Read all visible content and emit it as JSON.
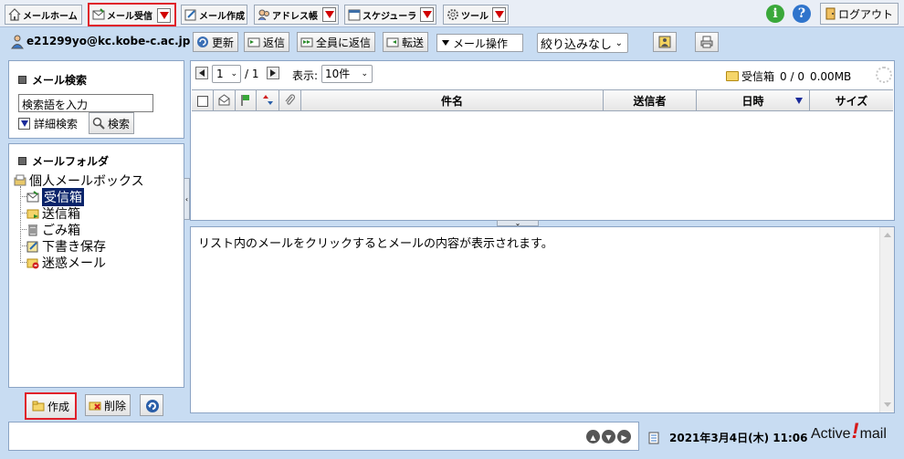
{
  "tabs": [
    {
      "label": "メールホーム",
      "icon": "home-icon"
    },
    {
      "label": "メール受信",
      "icon": "inbox-envelope-icon"
    },
    {
      "label": "メール作成",
      "icon": "compose-icon"
    },
    {
      "label": "アドレス帳",
      "icon": "address-book-icon"
    },
    {
      "label": "スケジューラ",
      "icon": "calendar-icon"
    },
    {
      "label": "ツール",
      "icon": "gear-icon"
    }
  ],
  "header": {
    "info_icon": "i",
    "help_icon": "?",
    "logout_label": "ログアウト"
  },
  "account": {
    "email": "e21299yo@kc.kobe-c.ac.jp"
  },
  "toolbar": {
    "refresh": "更新",
    "reply": "返信",
    "reply_all": "全員に返信",
    "forward": "転送",
    "mail_ops": "メール操作",
    "filter": "絞り込みなし"
  },
  "search": {
    "title": "メール検索",
    "placeholder": "検索語を入力",
    "advanced_label": "詳細検索",
    "search_button": "検索"
  },
  "folders": {
    "title": "メールフォルダ",
    "root": "個人メールボックス",
    "items": [
      {
        "label": "受信箱",
        "selected": true
      },
      {
        "label": "送信箱",
        "selected": false
      },
      {
        "label": "ごみ箱",
        "selected": false
      },
      {
        "label": "下書き保存",
        "selected": false
      },
      {
        "label": "迷惑メール",
        "selected": false
      }
    ]
  },
  "folder_actions": {
    "create": "作成",
    "delete": "削除"
  },
  "pager": {
    "page": "1",
    "total": "/ 1",
    "display_label": "表示:",
    "per_page": "10件"
  },
  "mailbox_status": {
    "folder": "受信箱",
    "count": "0 / 0",
    "size": "0.00MB"
  },
  "columns": {
    "subject": "件名",
    "sender": "送信者",
    "date": "日時",
    "size": "サイズ"
  },
  "preview": {
    "message": "リスト内のメールをクリックするとメールの内容が表示されます。"
  },
  "footer": {
    "datetime": "2021年3月4日(木) 11:06",
    "brand_left": "Active",
    "brand_mark": "!",
    "brand_right": "mail"
  },
  "colors": {
    "frame_bg": "#c8dcf2",
    "accent_red": "#e0202a",
    "selection": "#0a246a"
  }
}
